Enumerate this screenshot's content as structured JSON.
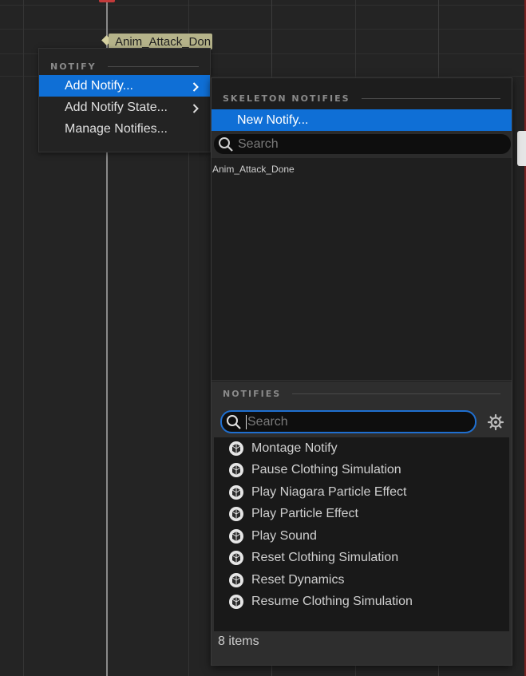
{
  "timeline": {
    "notify_chip_label": "Anim_Attack_Don"
  },
  "context_menu": {
    "section_header": "NOTIFY",
    "items": [
      {
        "label": "Add Notify...",
        "has_submenu": true,
        "active": true
      },
      {
        "label": "Add Notify State...",
        "has_submenu": true,
        "active": false
      },
      {
        "label": "Manage Notifies...",
        "has_submenu": false,
        "active": false
      }
    ]
  },
  "submenu": {
    "skeleton_header": "SKELETON NOTIFIES",
    "new_notify_label": "New Notify...",
    "skeleton_search": {
      "placeholder": "Search",
      "value": ""
    },
    "skeleton_notifies": [
      "Anim_Attack_Done"
    ],
    "notifies_header": "NOTIFIES",
    "notifies_search": {
      "placeholder": "Search",
      "value": ""
    },
    "notifies": [
      {
        "label": "Montage Notify",
        "icon": "blueprint-class-icon"
      },
      {
        "label": "Pause Clothing Simulation",
        "icon": "blueprint-class-icon"
      },
      {
        "label": "Play Niagara Particle Effect",
        "icon": "blueprint-class-icon"
      },
      {
        "label": "Play Particle Effect",
        "icon": "blueprint-class-icon"
      },
      {
        "label": "Play Sound",
        "icon": "blueprint-class-icon"
      },
      {
        "label": "Reset Clothing Simulation",
        "icon": "blueprint-class-icon"
      },
      {
        "label": "Reset Dynamics",
        "icon": "blueprint-class-icon"
      },
      {
        "label": "Resume Clothing Simulation",
        "icon": "blueprint-class-icon"
      }
    ],
    "item_count_label": "8 items"
  },
  "colors": {
    "accent": "#0f6fd6",
    "background": "#242424",
    "notify_chip": "#b5b38a",
    "playhead_top": "#c23a3a"
  }
}
